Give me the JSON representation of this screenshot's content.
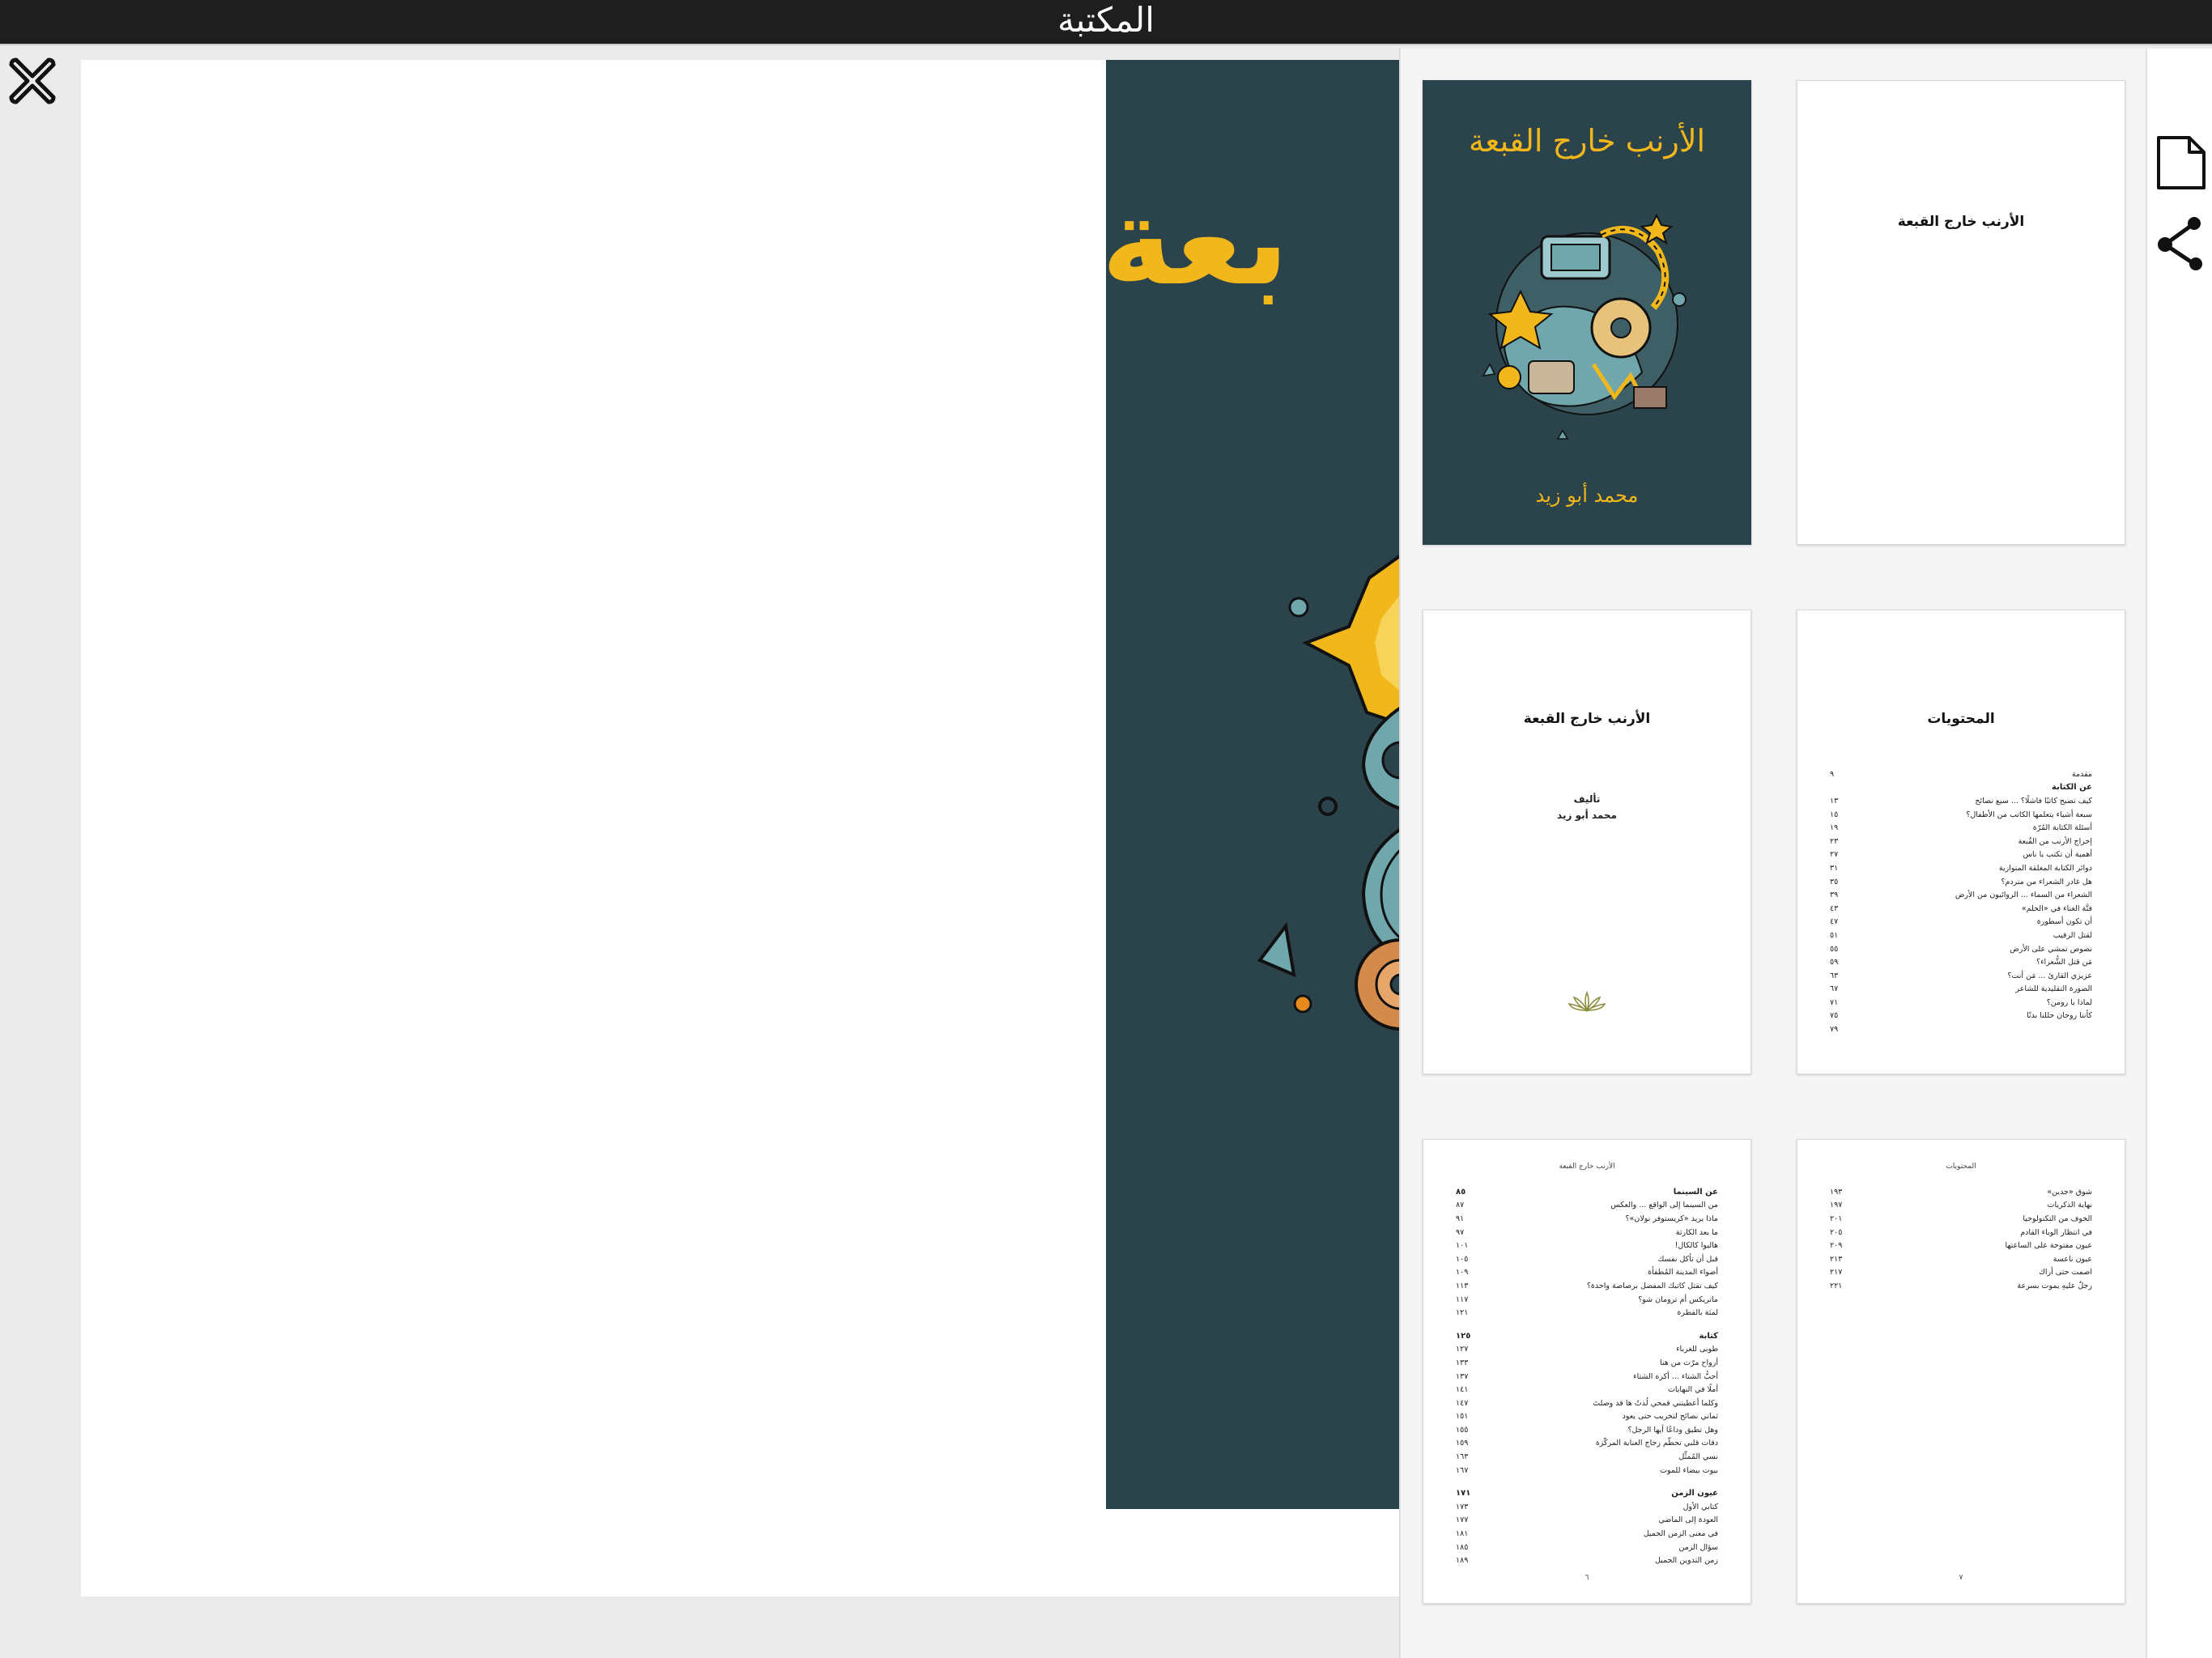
{
  "app": {
    "title": "المكتبة"
  },
  "viewer": {
    "cover_title_fragment": "بعة"
  },
  "book": {
    "title": "الأرنب خارج القبعة",
    "author": "محمد أبو زيد"
  },
  "colors": {
    "cover_bg": "#2b434a",
    "cover_accent": "#f2b81b",
    "topbar_bg": "#1e1e1e"
  },
  "icons": {
    "close": "close-x-icon",
    "page": "page-icon",
    "share": "share-icon"
  },
  "thumbnails": {
    "page3": {
      "title": "الأرنب خارج القبعة",
      "author_label": "تأليف",
      "author_name": "محمد أبو زيد"
    },
    "page4": {
      "heading": "المحتويات",
      "rows": [
        {
          "t": "مقدمة",
          "n": "٩"
        },
        {
          "t": "عن الكتابة",
          "n": "",
          "sec": true
        },
        {
          "t": "كيف تصبح كاتبًا فاشلًا؟ ... سبع نصائح",
          "n": "١٣"
        },
        {
          "t": "سبعة أشياء يتعلمها الكاتب من الأطفال؟",
          "n": "١٥"
        },
        {
          "t": "أسئلة الكتابة المُرّة",
          "n": "١٩"
        },
        {
          "t": "إخراج الأرنب من القُبعة",
          "n": "٢٣"
        },
        {
          "t": "أهمية أن تكتب يا ناس",
          "n": "٢٧"
        },
        {
          "t": "دوائر الكتابة المغلقة المتوازية",
          "n": "٣١"
        },
        {
          "t": "هل غادر الشعراء من متردم؟",
          "n": "٣٥"
        },
        {
          "t": "الشعراء من السماء ... الروائيون من الأرض",
          "n": "٣٩"
        },
        {
          "t": "فتَّة الغناء في «الحلم»",
          "n": "٤٣"
        },
        {
          "t": "أن تكون أسطورة",
          "n": "٤٧"
        },
        {
          "t": "لقتل الرقيب",
          "n": "٥١"
        },
        {
          "t": "نصوص تمشي على الأرض",
          "n": "٥٥"
        },
        {
          "t": "مَن قتل الشُّعراء؟",
          "n": "٥٩"
        },
        {
          "t": "عزيزي القارئ ... مَن أنت؟",
          "n": "٦٣"
        },
        {
          "t": "الصورة التقليدية للشاعر",
          "n": "٦٧"
        },
        {
          "t": "لماذا يا رومن؟",
          "n": "٧١"
        },
        {
          "t": "كأننا روحان حللنا بدنًا",
          "n": "٧٥"
        },
        {
          "t": "",
          "n": "٧٩"
        }
      ]
    },
    "page6": {
      "running_head": "الأرنب خارج القبعة",
      "rows": [
        {
          "t": "عن السينما",
          "n": "٨٥",
          "sec": true
        },
        {
          "t": "من السينما إلى الواقع ... والعكس",
          "n": "٨٧"
        },
        {
          "t": "ماذا يريد «كريستوفر نولان»؟",
          "n": "٩١"
        },
        {
          "t": "ما بعد الكارثة",
          "n": "٩٧"
        },
        {
          "t": "هاليوا كالكال!",
          "n": "١٠١"
        },
        {
          "t": "قبل أن تأكل نفسك",
          "n": "١٠٥"
        },
        {
          "t": "أضواء المدينة المُطفأة",
          "n": "١٠٩"
        },
        {
          "t": "كيف تقتل كاتبك المفضل برصاصة واحدة؟",
          "n": "١١٣"
        },
        {
          "t": "ماتريكس أم ترومان شو؟",
          "n": "١١٧"
        },
        {
          "t": "لمثة بالفطرة",
          "n": "١٢١"
        },
        {
          "gap": true
        },
        {
          "t": "كتابة",
          "n": "١٢٥",
          "sec": true
        },
        {
          "t": "طوبى للغرباء",
          "n": "١٢٧"
        },
        {
          "t": "أرواح مرّت من هنا",
          "n": "١٣٣"
        },
        {
          "t": "أحبُّ الشتاء ... أكره الشتاء",
          "n": "١٣٧"
        },
        {
          "t": "أملًا في النهايات",
          "n": "١٤١"
        },
        {
          "t": "وكلما أعطيتني قمحي لُذتُ ها قد وصلتَ",
          "n": "١٤٧"
        },
        {
          "t": "ثماني نصائح لتخريب حتى يعود",
          "n": "١٥١"
        },
        {
          "t": "وهل تطيق وداعًا أيها الرجل؟",
          "n": "١٥٥"
        },
        {
          "t": "دقات قلبي تحطّم زجاج العناية المركّزة",
          "n": "١٥٩"
        },
        {
          "t": "نسي المُمثِّل",
          "n": "١٦٣"
        },
        {
          "t": "بيوت بيضاء للموت",
          "n": "١٦٧"
        },
        {
          "gap": true
        },
        {
          "t": "عيون الزمن",
          "n": "١٧١",
          "sec": true
        },
        {
          "t": "كتابي الأول",
          "n": "١٧٣"
        },
        {
          "t": "العودة إلى الماضي",
          "n": "١٧٧"
        },
        {
          "t": "في معنى الزمن الجميل",
          "n": "١٨١"
        },
        {
          "t": "سؤال الزمن",
          "n": "١٨٥"
        },
        {
          "t": "زمن التدوين الجميل",
          "n": "١٨٩"
        }
      ],
      "page_number": "٦"
    },
    "page7": {
      "running_head": "المحتويات",
      "rows": [
        {
          "t": "شوق «جدين»",
          "n": "١٩٣"
        },
        {
          "t": "نهاية الذكريات",
          "n": "١٩٧"
        },
        {
          "t": "الخوف من التكنولوجيا",
          "n": "٢٠١"
        },
        {
          "t": "في انتظار الوباء القادم",
          "n": "٢٠٥"
        },
        {
          "t": "عيون مفتوحة على الساعتها",
          "n": "٢٠٩"
        },
        {
          "t": "عيون ناعسة",
          "n": "٢١٣"
        },
        {
          "t": "اصمت حتى أراك",
          "n": "٢١٧"
        },
        {
          "t": "رجلٌ عليهِ يموت بسرعة",
          "n": "٢٢١"
        }
      ],
      "page_number": "٧"
    }
  }
}
